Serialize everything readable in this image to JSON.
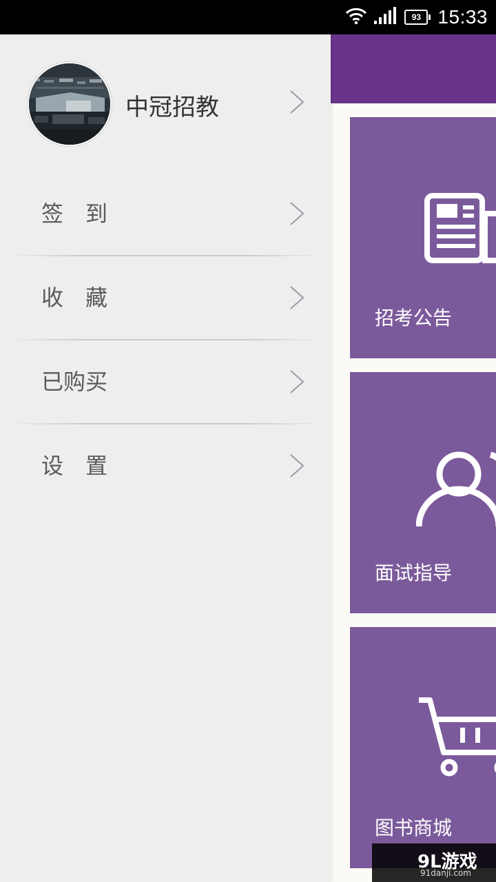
{
  "status_bar": {
    "time": "15:33",
    "battery": "93",
    "wifi_icon": "wifi-icon",
    "signal_icon": "signal-icon"
  },
  "drawer": {
    "profile": {
      "name": "中冠招教",
      "avatar_icon": "avatar-building-photo",
      "chevron_icon": "chevron-right-icon"
    },
    "items": [
      {
        "label": "签　到",
        "icon": "chevron-right-icon"
      },
      {
        "label": "收　藏",
        "icon": "chevron-right-icon"
      },
      {
        "label": "已购买",
        "icon": "chevron-right-icon"
      },
      {
        "label": "设　置",
        "icon": "chevron-right-icon"
      }
    ]
  },
  "main": {
    "header_color": "#6a348a",
    "tile_color": "#7b5a9b",
    "tiles": [
      {
        "label": "招考公告",
        "icon": "newspaper-icon"
      },
      {
        "label": "面试指导",
        "icon": "users-icon"
      },
      {
        "label": "图书商城",
        "icon": "cart-icon"
      }
    ]
  },
  "watermark": {
    "brand": "9L游戏",
    "url": "91danji.com"
  }
}
